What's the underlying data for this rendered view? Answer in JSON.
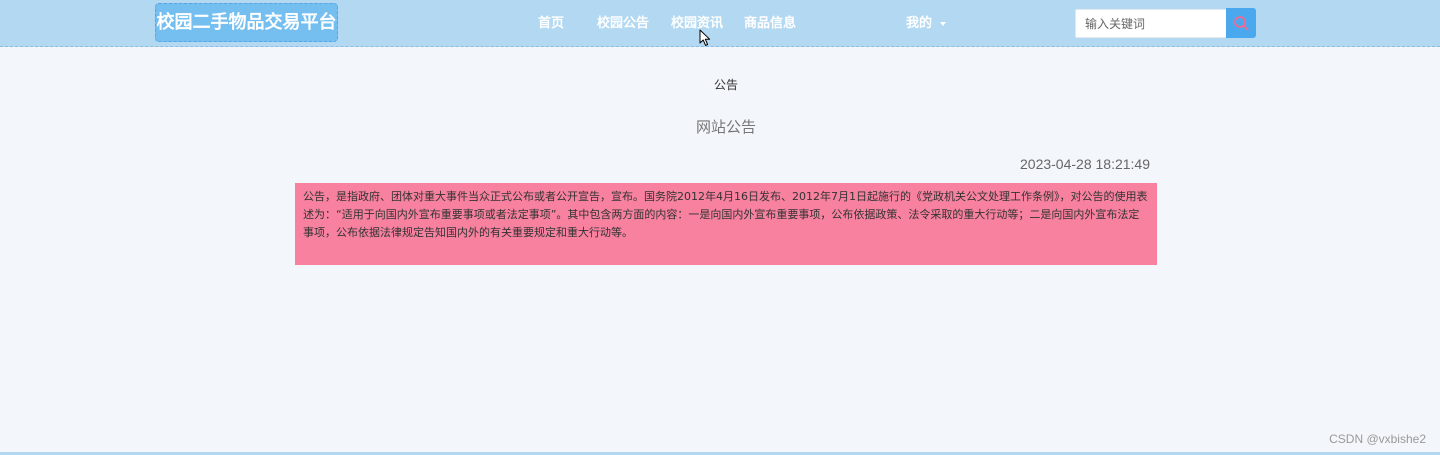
{
  "header": {
    "brand": "校园二手物品交易平台",
    "nav": {
      "home": "首页",
      "notice": "校园公告",
      "news": "校园资讯",
      "goods": "商品信息",
      "mine": "我的"
    },
    "search": {
      "placeholder": "输入关键词",
      "value": ""
    },
    "icons": {
      "search": "search-icon",
      "caret": "chevron-down-icon",
      "cursor": "mouse-pointer-icon"
    }
  },
  "main": {
    "breadcrumb": "公告",
    "title": "网站公告",
    "time": "2023-04-28 18:21:49",
    "content": "公告，是指政府、团体对重大事件当众正式公布或者公开宣告，宣布。国务院2012年4月16日发布、2012年7月1日起施行的《党政机关公文处理工作条例》，对公告的使用表述为：“适用于向国内外宣布重要事项或者法定事项”。其中包含两方面的内容：一是向国内外宣布重要事项，公布依据政策、法令采取的重大行动等；二是向国内外宣布法定事项，公布依据法律规定告知国内外的有关重要规定和重大行动等。"
  },
  "footer": {
    "watermark": "CSDN @vxbishe2"
  },
  "colors": {
    "navbar": "#b3d9f2",
    "brand": "#75bff0",
    "search_button": "#4aa8ee",
    "search_icon": "#f06b8f",
    "notice_background": "#f7819f",
    "page_background": "#f3f6fa"
  }
}
